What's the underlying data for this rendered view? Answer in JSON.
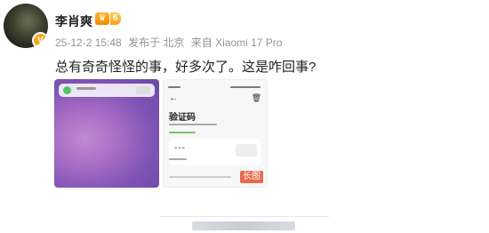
{
  "user": {
    "name": "李肖爽",
    "vip_badge": "6",
    "avatar_badge": "V"
  },
  "meta": {
    "timestamp": "25-12-2 15:48",
    "location": "发布于 北京",
    "source": "来自 Xiaomi 17 Pro"
  },
  "post": {
    "text": "总有奇奇怪怪的事，好多次了。这是咋回事?",
    "images": [
      {
        "kind": "screenshot-notification"
      },
      {
        "kind": "screenshot-verification",
        "title": "验证码",
        "long_tag": "长图"
      }
    ]
  },
  "colors": {
    "accent": "#f5a623",
    "meta_text": "#939393",
    "long_tag": "#e86a4d"
  }
}
